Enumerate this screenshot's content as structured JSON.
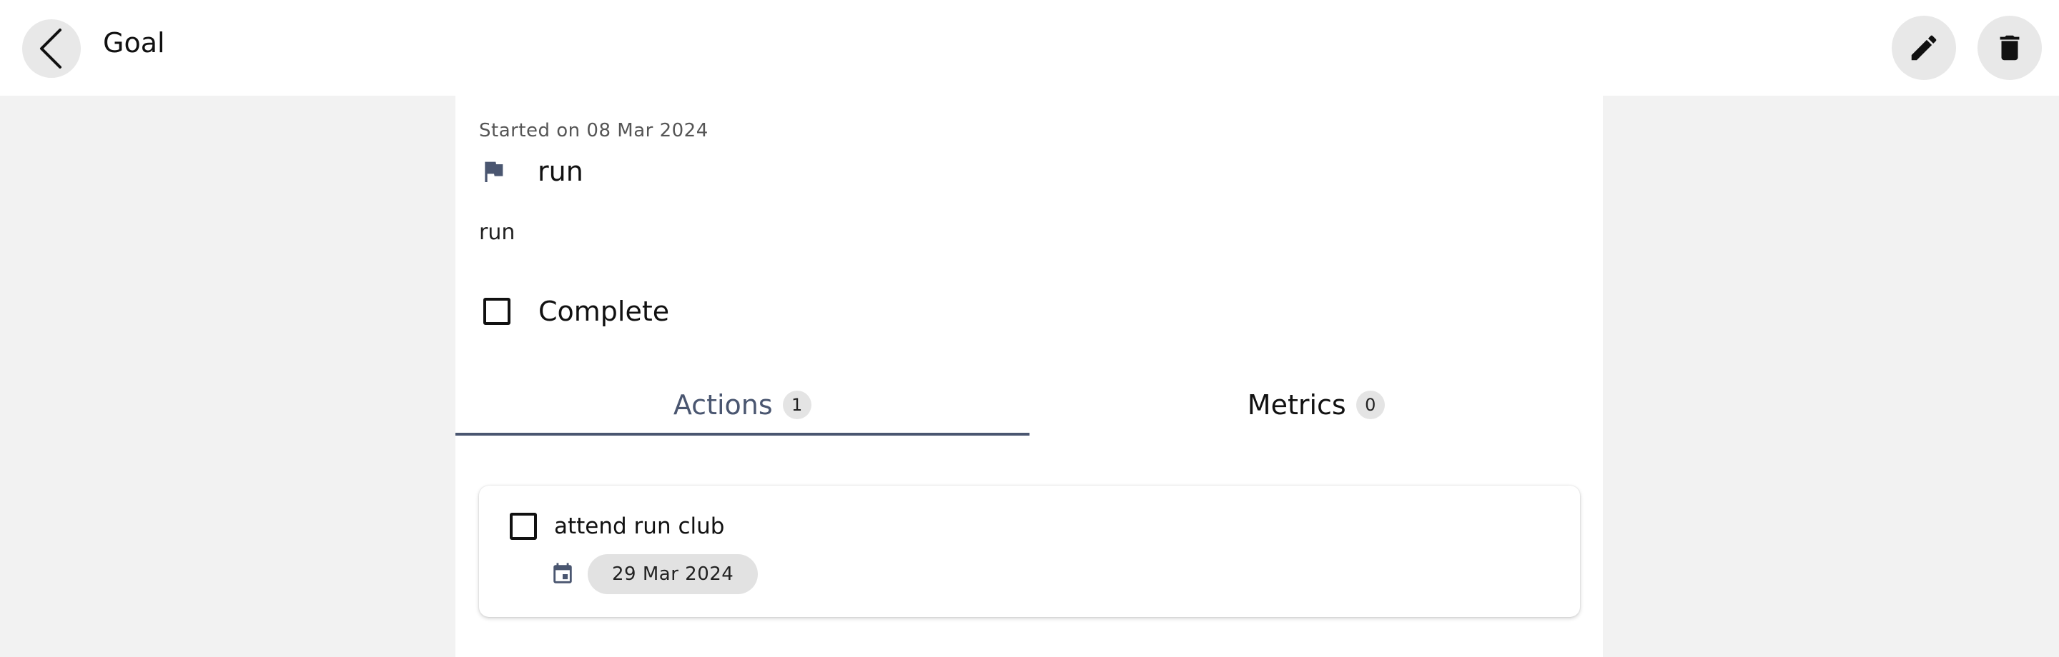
{
  "appbar": {
    "title": "Goal",
    "back_icon": "chevron-left-icon",
    "edit_icon": "pencil-icon",
    "delete_icon": "trash-icon"
  },
  "goal": {
    "started_text": "Started on 08 Mar 2024",
    "flag_icon": "flag-icon",
    "title": "run",
    "description": "run",
    "complete_label": "Complete",
    "complete_checked": false
  },
  "tabs": [
    {
      "label": "Actions",
      "count": "1",
      "active": true
    },
    {
      "label": "Metrics",
      "count": "0",
      "active": false
    }
  ],
  "actions": [
    {
      "title": "attend run club",
      "checked": false,
      "date_icon": "calendar-icon",
      "date": "29 Mar 2024"
    }
  ],
  "colors": {
    "accent": "#4a5670",
    "page_bg": "#f2f2f2",
    "surface": "#ffffff",
    "chip_bg": "#e2e2e2"
  }
}
